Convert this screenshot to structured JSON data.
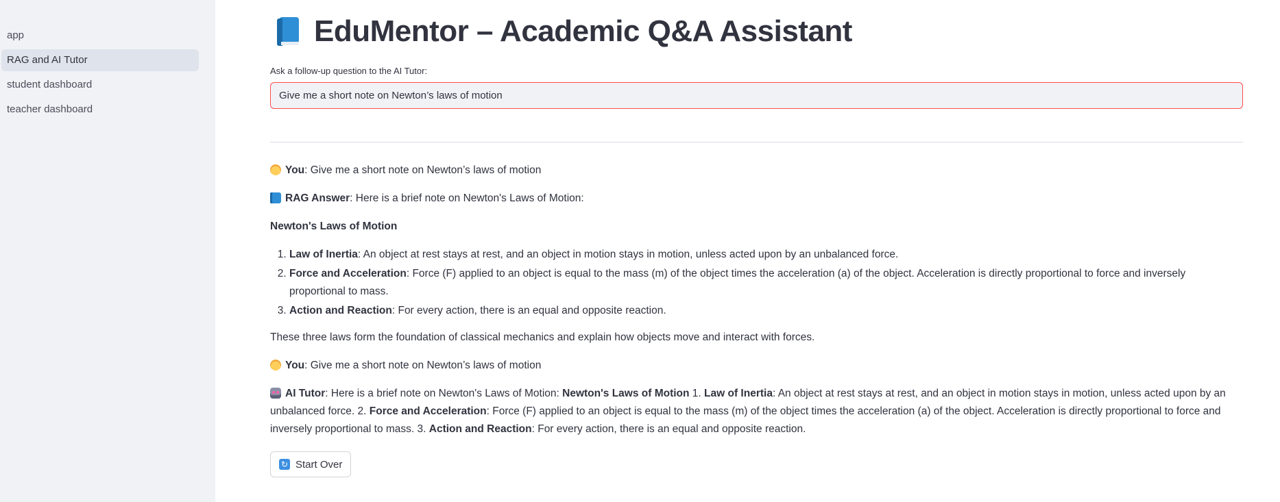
{
  "sidebar": {
    "items": [
      {
        "label": "app"
      },
      {
        "label": "RAG and AI Tutor"
      },
      {
        "label": "student dashboard"
      },
      {
        "label": "teacher dashboard"
      }
    ]
  },
  "header": {
    "title": "EduMentor – Academic Q&A Assistant",
    "icon": "book-icon"
  },
  "question_input": {
    "label": "Ask a follow-up question to the AI Tutor:",
    "value": "Give me a short note on Newton’s laws of motion",
    "border_color": "#ff4b4b"
  },
  "chat": {
    "you_label": "You",
    "you_message_1": ": Give me a short note on Newton’s laws of motion",
    "rag_label": "RAG Answer",
    "rag_intro": ": Here is a brief note on Newton's Laws of Motion:",
    "rag_heading": "Newton's Laws of Motion",
    "laws": [
      {
        "name": "Law of Inertia",
        "text": ": An object at rest stays at rest, and an object in motion stays in motion, unless acted upon by an unbalanced force."
      },
      {
        "name": "Force and Acceleration",
        "text": ": Force (F) applied to an object is equal to the mass (m) of the object times the acceleration (a) of the object. Acceleration is directly proportional to force and inversely proportional to mass."
      },
      {
        "name": "Action and Reaction",
        "text": ": For every action, there is an equal and opposite reaction."
      }
    ],
    "rag_conclusion": "These three laws form the foundation of classical mechanics and explain how objects move and interact with forces.",
    "you_message_2": ": Give me a short note on Newton’s laws of motion",
    "tutor_label": "AI Tutor",
    "tutor_part_1": ": Here is a brief note on Newton's Laws of Motion: ",
    "tutor_heading": "Newton's Laws of Motion",
    "tutor_part_2": " 1. ",
    "tutor_law_1": "Law of Inertia",
    "tutor_part_3": ": An object at rest stays at rest, and an object in motion stays in motion, unless acted upon by an unbalanced force. 2. ",
    "tutor_law_2": "Force and Acceleration",
    "tutor_part_4": ": Force (F) applied to an object is equal to the mass (m) of the object times the acceleration (a) of the object. Acceleration is directly proportional to force and inversely proportional to mass. 3. ",
    "tutor_law_3": "Action and Reaction",
    "tutor_part_5": ": For every action, there is an equal and opposite reaction."
  },
  "actions": {
    "start_over_label": "Start Over",
    "start_over_icon": "refresh-icon"
  },
  "colors": {
    "sidebar_bg": "#f0f2f6",
    "active_nav_bg": "#dfe3ec",
    "text": "#31333f",
    "input_border": "#ff4b4b"
  }
}
